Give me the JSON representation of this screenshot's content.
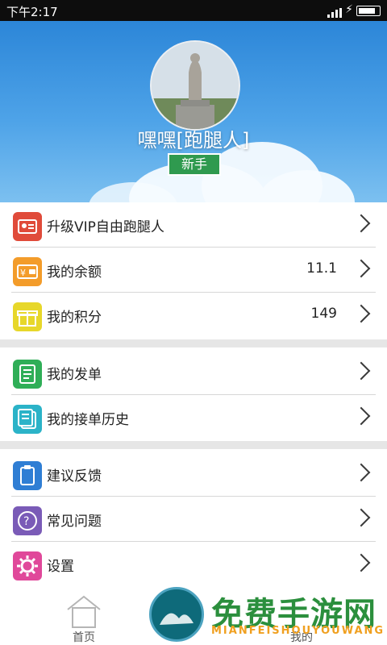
{
  "status_bar": {
    "time": "下午2:17"
  },
  "profile": {
    "username": "嘿嘿[跑腿人]",
    "level_badge": "新手"
  },
  "menu_section_1": [
    {
      "label": "升级VIP自由跑腿人",
      "value": "",
      "icon": "vip-card-icon",
      "color": "#e04b3a"
    },
    {
      "label": "我的余额",
      "value": "11.1",
      "icon": "wallet-icon",
      "color": "#f39c2a"
    },
    {
      "label": "我的积分",
      "value": "149",
      "icon": "gift-icon",
      "color": "#e7d72a"
    }
  ],
  "menu_section_2": [
    {
      "label": "我的发单",
      "icon": "notebook-icon",
      "color": "#2fae57"
    },
    {
      "label": "我的接单历史",
      "icon": "history-notebook-icon",
      "color": "#2bb3c8"
    }
  ],
  "menu_section_3": [
    {
      "label": "建议反馈",
      "icon": "clipboard-icon",
      "color": "#2f7ed4"
    },
    {
      "label": "常见问题",
      "icon": "question-icon",
      "color": "#7a5bb7"
    },
    {
      "label": "设置",
      "icon": "gear-icon",
      "color": "#e0489a"
    }
  ],
  "bottom_nav": {
    "home_label": "首页",
    "mine_label": "我的"
  },
  "watermark": {
    "title": "免费手游网",
    "subtitle": "MIANFEISHOUYOUWANG"
  }
}
